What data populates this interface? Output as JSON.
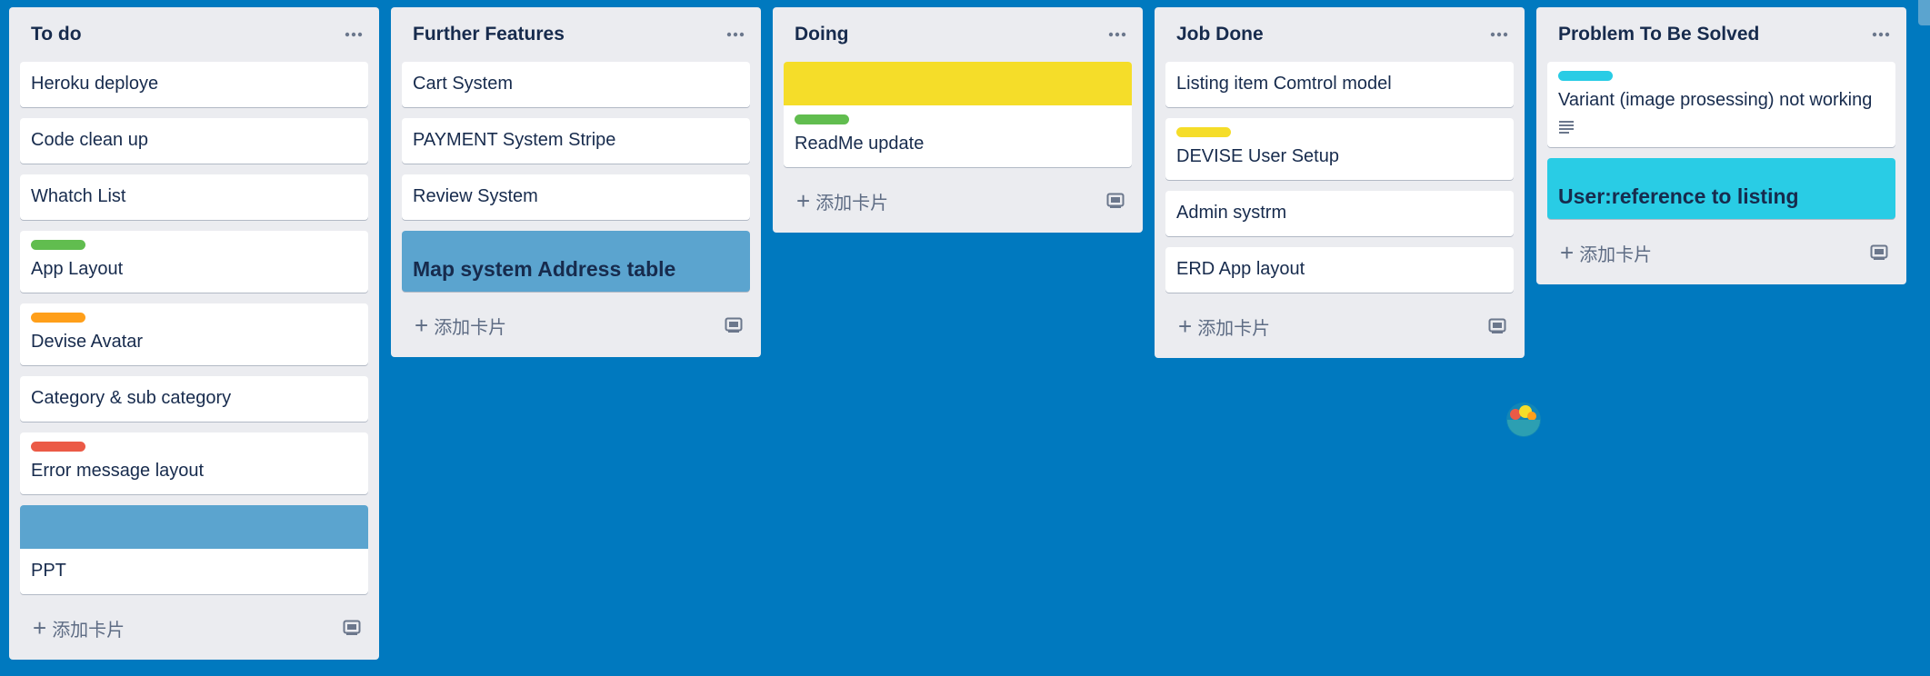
{
  "board": {
    "add_card_label": "添加卡片",
    "colors": {
      "background": "#0079bf",
      "list_bg": "#ebecf0",
      "green": "#61bd4f",
      "orange": "#ff9f1a",
      "red": "#eb5a46",
      "yellow": "#f5dd29",
      "blue": "#5ba4cf",
      "sky": "#29cce5"
    },
    "lists": [
      {
        "title": "To do",
        "cards": [
          {
            "title": "Heroku deploye"
          },
          {
            "title": "Code clean up"
          },
          {
            "title": "Whatch List"
          },
          {
            "title": "App Layout",
            "label_color": "#61bd4f"
          },
          {
            "title": "Devise Avatar",
            "label_color": "#ff9f1a"
          },
          {
            "title": "Category & sub category"
          },
          {
            "title": "Error message layout",
            "label_color": "#eb5a46"
          },
          {
            "title": "PPT",
            "cover_color": "#5ba4cf"
          }
        ]
      },
      {
        "title": "Further Features",
        "cards": [
          {
            "title": "Cart System"
          },
          {
            "title": "PAYMENT System Stripe"
          },
          {
            "title": "Review System"
          },
          {
            "title": "Map system Address table",
            "full_cover_color": "#5ba4cf"
          }
        ]
      },
      {
        "title": "Doing",
        "cards": [
          {
            "title": "ReadMe update",
            "cover_color": "#f5dd29",
            "label_color": "#61bd4f"
          }
        ]
      },
      {
        "title": "Job Done",
        "cards": [
          {
            "title": "Listing item Comtrol model"
          },
          {
            "title": "DEVISE User Setup",
            "label_color": "#f5dd29"
          },
          {
            "title": "Admin systrm"
          },
          {
            "title": "ERD App layout"
          }
        ]
      },
      {
        "title": "Problem To Be Solved",
        "cards": [
          {
            "title": "Variant (image prosessing) not working",
            "label_color": "#29cce5",
            "badge": "description-icon"
          },
          {
            "title": "User:reference to listing",
            "full_cover_color": "#29cce5"
          }
        ]
      }
    ]
  }
}
